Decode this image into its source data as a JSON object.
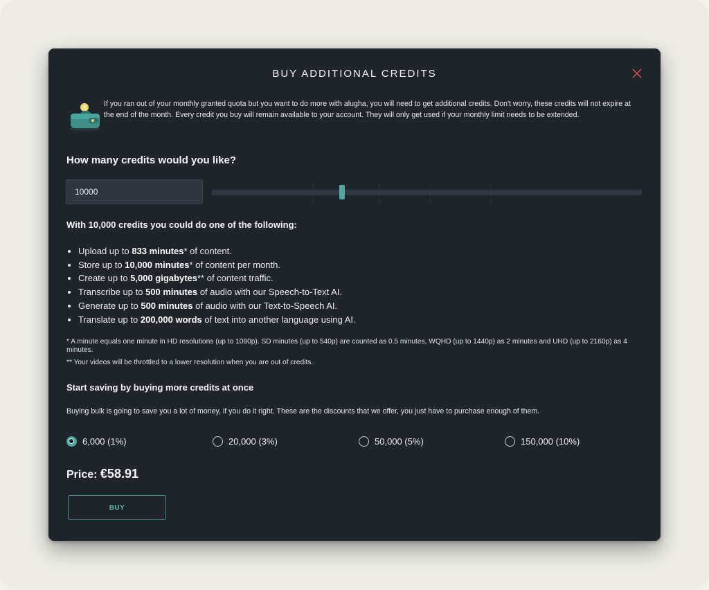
{
  "modal": {
    "title": "BUY ADDITIONAL CREDITS",
    "intro_text": "If you ran out of your monthly granted quota but you want to do more with alugha, you will need to get additional credits. Don't worry, these credits will not expire at the end of the month. Every credit you buy will remain available to your account. They will only get used if your monthly limit needs to be extended.",
    "icon": "wallet-with-coin-icon"
  },
  "credits": {
    "question": "How many credits would you like?",
    "value": "10000",
    "slider_fraction": 0.3
  },
  "benefits": {
    "heading": "With 10,000 credits you could do one of the following:",
    "items": [
      {
        "pre": "Upload up to ",
        "bold": "833 minutes",
        "post": "* of content."
      },
      {
        "pre": "Store up to ",
        "bold": "10,000 minutes",
        "post": "* of content per month."
      },
      {
        "pre": "Create up to ",
        "bold": "5,000 gigabytes",
        "post": "** of content traffic."
      },
      {
        "pre": "Transcribe up to ",
        "bold": "500 minutes",
        "post": " of audio with our Speech-to-Text AI."
      },
      {
        "pre": "Generate up to ",
        "bold": "500 minutes",
        "post": " of audio with our Text-to-Speech AI."
      },
      {
        "pre": "Translate up to ",
        "bold": "200,000 words",
        "post": " of text into another language using AI."
      }
    ],
    "footnote_1": "* A minute equals one minute in HD resolutions (up to 1080p). SD minutes (up to 540p) are counted as 0.5 minutes, WQHD (up to 1440p) as 2 minutes and UHD (up to 2160p) as 4 minutes.",
    "footnote_2": "** Your videos will be throttled to a lower resolution when you are out of credits."
  },
  "bulk": {
    "heading": "Start saving by buying more credits at once",
    "text": "Buying bulk is going to save you a lot of money, if you do it right. These are the discounts that we offer, you just have to purchase enough of them.",
    "options": [
      {
        "label": "6,000 (1%)",
        "checked": true
      },
      {
        "label": "20,000 (3%)",
        "checked": false
      },
      {
        "label": "50,000 (5%)",
        "checked": false
      },
      {
        "label": "150,000 (10%)",
        "checked": false
      }
    ]
  },
  "price": {
    "label": "Price: ",
    "amount": "€58.91"
  },
  "buy_button": "BUY",
  "colors": {
    "accent": "#4fa89f",
    "modal_bg": "#20252c",
    "close": "#c0504d"
  }
}
